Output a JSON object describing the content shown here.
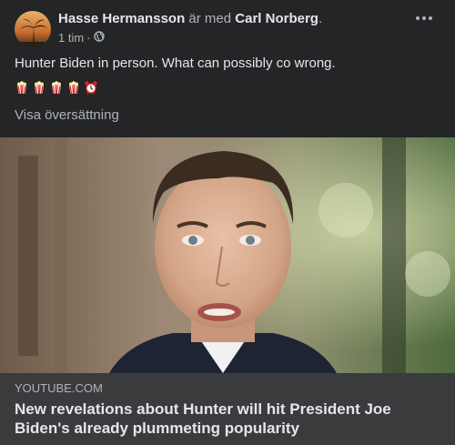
{
  "post": {
    "author": "Hasse Hermansson",
    "with_text": "är med",
    "tagged": "Carl Norberg",
    "period": ".",
    "time": "1 tim",
    "dot": "·",
    "privacy_icon": "globe-icon",
    "text": "Hunter Biden in person. What can possibly co wrong.",
    "emojis": [
      "popcorn-emoji",
      "popcorn-emoji",
      "popcorn-emoji",
      "popcorn-emoji",
      "alarm-clock-emoji"
    ],
    "translate_label": "Visa översättning"
  },
  "link": {
    "domain": "YOUTUBE.COM",
    "title": "New revelations about Hunter will hit President Joe Biden's already plummeting popularity"
  },
  "colors": {
    "card_bg": "#242526",
    "link_bg": "#3a3b3c",
    "primary_text": "#e4e6eb",
    "secondary_text": "#b0b3b8"
  }
}
